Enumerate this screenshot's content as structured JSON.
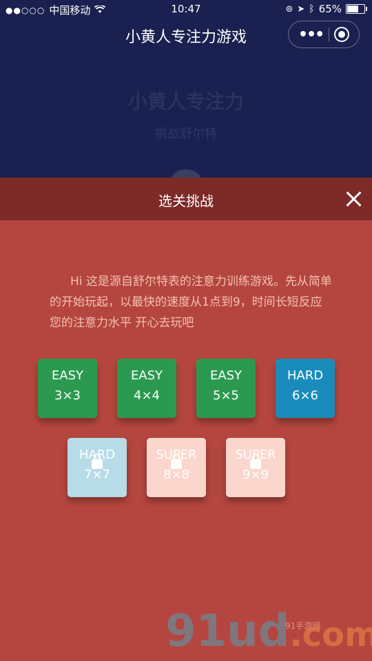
{
  "status": {
    "carrier": "中国移动",
    "signal_dots": "●●○○○",
    "time": "10:47",
    "battery": "65%"
  },
  "nav": {
    "title": "小黄人专注力游戏"
  },
  "background": {
    "title": "小黄人专注力",
    "subtitle": "挑战舒尔特"
  },
  "modal": {
    "title": "选关挑战",
    "description": "Hi 这是源自舒尔特表的注意力训练游戏。先从简单的开始玩起，以最快的速度从1点到9，时间长短反应您的注意力水平 开心去玩吧"
  },
  "levels": [
    {
      "label": "EASY",
      "size": "3×3",
      "locked": false,
      "color": "#2b9a50"
    },
    {
      "label": "EASY",
      "size": "4×4",
      "locked": false,
      "color": "#2b9a50"
    },
    {
      "label": "EASY",
      "size": "5×5",
      "locked": false,
      "color": "#2b9a50"
    },
    {
      "label": "HARD",
      "size": "6×6",
      "locked": false,
      "color": "#1a8cbb"
    },
    {
      "label": "HARD",
      "size": "7×7",
      "locked": true,
      "color": "#b8dbe8"
    },
    {
      "label": "SUPER",
      "size": "8×8",
      "locked": true,
      "color": "#fbd6cd"
    },
    {
      "label": "SUPER",
      "size": "9×9",
      "locked": true,
      "color": "#fbd6cd"
    }
  ],
  "watermark": {
    "main": "91ud",
    "suffix": ".com",
    "small": "91手游网"
  }
}
